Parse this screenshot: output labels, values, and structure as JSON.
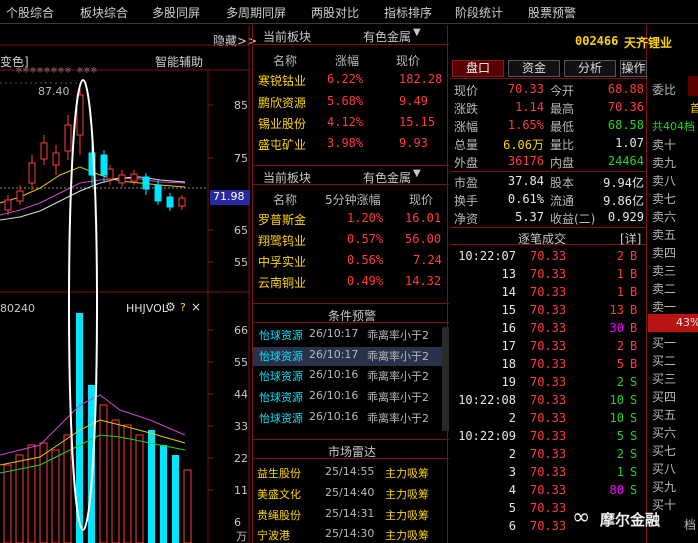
{
  "top_tabs": [
    "个股综合",
    "板块综合",
    "多股同屏",
    "多周期同屏",
    "两股对比",
    "指标排序",
    "阶段统计",
    "股票预警"
  ],
  "chart": {
    "left_label": "变色]",
    "stars": "******** ***",
    "assist": "智能辅助",
    "hide_btn": "隐藏>>",
    "high_price": "87.40",
    "cur_price_tag": "71.98",
    "price_axis": [
      "85",
      "75",
      "65",
      "55"
    ],
    "vol_label": "80240",
    "vol_indicator": "HHJVOL",
    "vol_axis": [
      "66",
      "55",
      "44",
      "33",
      "22",
      "11",
      "6"
    ],
    "vol_unit": "万"
  },
  "sector1": {
    "title": "当前板块",
    "filter": "有色金属",
    "headers": [
      "名称",
      "涨幅",
      "现价"
    ],
    "rows": [
      {
        "name": "寒锐钴业",
        "pct": "6.22%",
        "price": "182.28"
      },
      {
        "name": "鹏欣资源",
        "pct": "5.68%",
        "price": "9.49"
      },
      {
        "name": "锡业股份",
        "pct": "4.12%",
        "price": "15.15"
      },
      {
        "name": "盛屯矿业",
        "pct": "3.98%",
        "price": "9.93"
      }
    ]
  },
  "sector2": {
    "title": "当前板块",
    "filter": "有色金属",
    "headers": [
      "名称",
      "5分钟涨幅",
      "现价"
    ],
    "rows": [
      {
        "name": "罗普斯金",
        "pct": "1.20%",
        "price": "16.01"
      },
      {
        "name": "翔鹭钨业",
        "pct": "0.57%",
        "price": "56.00"
      },
      {
        "name": "中孚实业",
        "pct": "0.56%",
        "price": "7.24"
      },
      {
        "name": "云南铜业",
        "pct": "0.49%",
        "price": "14.32"
      }
    ]
  },
  "alerts": {
    "title": "条件预警",
    "rows": [
      {
        "name": "怡球资源",
        "time": "26/10:17",
        "msg": "乖离率小于2"
      },
      {
        "name": "怡球资源",
        "time": "26/10:17",
        "msg": "乖离率小于2"
      },
      {
        "name": "怡球资源",
        "time": "26/10:16",
        "msg": "乖离率小于2"
      },
      {
        "name": "怡球资源",
        "time": "26/10:16",
        "msg": "乖离率小于2"
      },
      {
        "name": "怡球资源",
        "time": "26/10:16",
        "msg": "乖离率小于2"
      }
    ]
  },
  "radar": {
    "title": "市场雷达",
    "rows": [
      {
        "name": "益生股份",
        "time": "25/14:55",
        "msg": "主力吸筹"
      },
      {
        "name": "美盛文化",
        "time": "25/14:40",
        "msg": "主力吸筹"
      },
      {
        "name": "贵绳股份",
        "time": "25/14:31",
        "msg": "主力吸筹"
      },
      {
        "name": "宁波港",
        "time": "25/14:30",
        "msg": "主力吸筹"
      }
    ]
  },
  "stock": {
    "code": "002466",
    "name": "天齐锂业",
    "tabs": [
      "盘口",
      "资金",
      "分析",
      "操作"
    ],
    "quote": [
      {
        "l1": "现价",
        "v1": "70.33",
        "l2": "今开",
        "v2": "68.88"
      },
      {
        "l1": "涨跌",
        "v1": "1.14",
        "l2": "最高",
        "v2": "70.36"
      },
      {
        "l1": "涨幅",
        "v1": "1.65%",
        "l2": "最低",
        "v2": "68.58"
      },
      {
        "l1": "总量",
        "v1": "6.06万",
        "l2": "量比",
        "v2": "1.07"
      },
      {
        "l1": "外盘",
        "v1": "36176",
        "l2": "内盘",
        "v2": "24464"
      }
    ],
    "fundamentals": [
      {
        "l1": "市盈",
        "v1": "37.84",
        "l2": "股本",
        "v2": "9.94亿"
      },
      {
        "l1": "换手",
        "v1": "0.61%",
        "l2": "流通",
        "v2": "9.86亿"
      },
      {
        "l1": "净资",
        "v1": "5.37",
        "l2": "收益(二)",
        "v2": "0.929"
      }
    ]
  },
  "ticks": {
    "title": "逐笔成交",
    "detail_btn": "[详]",
    "rows": [
      {
        "time": "10:22:07",
        "price": "70.33",
        "vol": "2",
        "side": "B"
      },
      {
        "time": "13",
        "price": "70.33",
        "vol": "1",
        "side": "B"
      },
      {
        "time": "14",
        "price": "70.33",
        "vol": "1",
        "side": "B"
      },
      {
        "time": "15",
        "price": "70.33",
        "vol": "13",
        "side": "B"
      },
      {
        "time": "16",
        "price": "70.33",
        "vol": "30",
        "side": "B"
      },
      {
        "time": "17",
        "price": "70.33",
        "vol": "2",
        "side": "B"
      },
      {
        "time": "18",
        "price": "70.33",
        "vol": "5",
        "side": "B"
      },
      {
        "time": "19",
        "price": "70.33",
        "vol": "2",
        "side": "S"
      },
      {
        "time": "10:22:08",
        "price": "70.33",
        "vol": "10",
        "side": "S"
      },
      {
        "time": "2",
        "price": "70.33",
        "vol": "10",
        "side": "S"
      },
      {
        "time": "10:22:09",
        "price": "70.33",
        "vol": "5",
        "side": "S"
      },
      {
        "time": "2",
        "price": "70.33",
        "vol": "2",
        "side": "S"
      },
      {
        "time": "3",
        "price": "70.33",
        "vol": "1",
        "side": "S"
      },
      {
        "time": "4",
        "price": "70.33",
        "vol": "80",
        "side": "S"
      },
      {
        "time": "5",
        "price": "70.33",
        "vol": "",
        "side": ""
      },
      {
        "time": "6",
        "price": "70.33",
        "vol": "",
        "side": ""
      }
    ]
  },
  "orderbook": {
    "weibi": "委比",
    "tag": "首",
    "total": "共404档",
    "sell": [
      "卖十",
      "卖九",
      "卖八",
      "卖七",
      "卖六",
      "卖五",
      "卖四",
      "卖三",
      "卖二",
      "卖一"
    ],
    "pct": "43%",
    "buy": [
      "买一",
      "买二",
      "买三",
      "买四",
      "买五",
      "买六",
      "买七",
      "买八",
      "买九",
      "买十"
    ],
    "last": "档"
  },
  "watermark": "摩尔金融"
}
